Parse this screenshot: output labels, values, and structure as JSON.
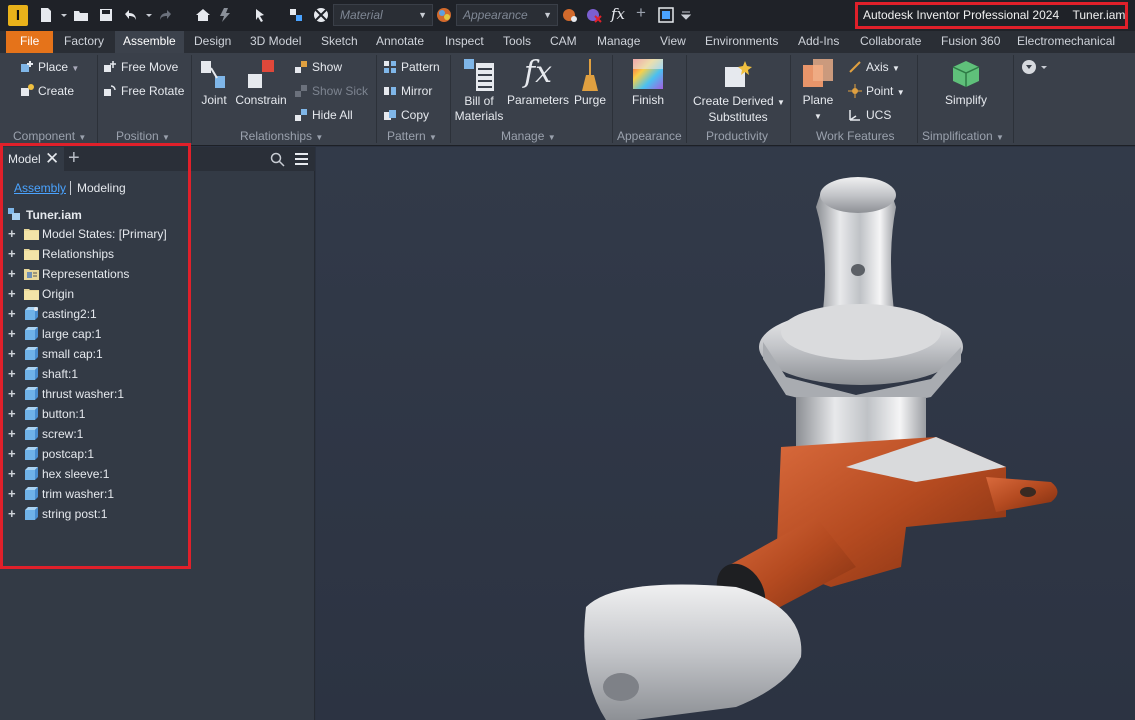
{
  "window": {
    "app_icon_letter": "I",
    "title": "Autodesk Inventor Professional 2024",
    "document": "Tuner.iam"
  },
  "quick_access": {
    "material_placeholder": "Material",
    "appearance_placeholder": "Appearance"
  },
  "tabs": [
    "File",
    "Factory",
    "Assemble",
    "Design",
    "3D Model",
    "Sketch",
    "Annotate",
    "Inspect",
    "Tools",
    "CAM",
    "Manage",
    "View",
    "Environments",
    "Add-Ins",
    "Collaborate",
    "Fusion 360",
    "Electromechanical"
  ],
  "active_tab": "Assemble",
  "ribbon": {
    "component": {
      "place": "Place",
      "create": "Create",
      "label": "Component"
    },
    "position": {
      "free_move": "Free Move",
      "free_rotate": "Free Rotate",
      "label": "Position"
    },
    "relationships": {
      "joint": "Joint",
      "constrain": "Constrain",
      "show": "Show",
      "show_sick": "Show Sick",
      "hide_all": "Hide All",
      "label": "Relationships"
    },
    "pattern": {
      "pattern": "Pattern",
      "mirror": "Mirror",
      "copy": "Copy",
      "label": "Pattern"
    },
    "manage": {
      "bom_line1": "Bill of",
      "bom_line2": "Materials",
      "parameters": "Parameters",
      "purge": "Purge",
      "label": "Manage"
    },
    "appearance": {
      "finish": "Finish",
      "label": "Appearance"
    },
    "productivity": {
      "cds_line1": "Create Derived",
      "cds_line2": "Substitutes",
      "label": "Productivity"
    },
    "work_features": {
      "plane": "Plane",
      "axis": "Axis",
      "point": "Point",
      "ucs": "UCS",
      "label": "Work Features"
    },
    "simplification": {
      "simplify": "Simplify",
      "label": "Simplification"
    }
  },
  "browser": {
    "tab_label": "Model",
    "subtab_assembly": "Assembly",
    "subtab_modeling": "Modeling",
    "root": "Tuner.iam",
    "items": [
      {
        "label": "Model States: [Primary]",
        "icon": "folder-icon"
      },
      {
        "label": "Relationships",
        "icon": "folder-icon"
      },
      {
        "label": "Representations",
        "icon": "representations-folder-icon"
      },
      {
        "label": "Origin",
        "icon": "folder-icon"
      },
      {
        "label": "casting2:1",
        "icon": "part-adaptive-icon"
      },
      {
        "label": "large cap:1",
        "icon": "part-icon"
      },
      {
        "label": "small cap:1",
        "icon": "part-icon"
      },
      {
        "label": "shaft:1",
        "icon": "part-icon"
      },
      {
        "label": "thrust washer:1",
        "icon": "part-icon"
      },
      {
        "label": "button:1",
        "icon": "part-icon"
      },
      {
        "label": "screw:1",
        "icon": "part-icon"
      },
      {
        "label": "postcap:1",
        "icon": "part-icon"
      },
      {
        "label": "hex sleeve:1",
        "icon": "part-icon"
      },
      {
        "label": "trim washer:1",
        "icon": "part-icon"
      },
      {
        "label": "string post:1",
        "icon": "part-icon"
      }
    ]
  },
  "colors": {
    "accent_orange": "#e5731a",
    "highlight_red": "#e0202a",
    "link_blue": "#4aa3ff"
  }
}
